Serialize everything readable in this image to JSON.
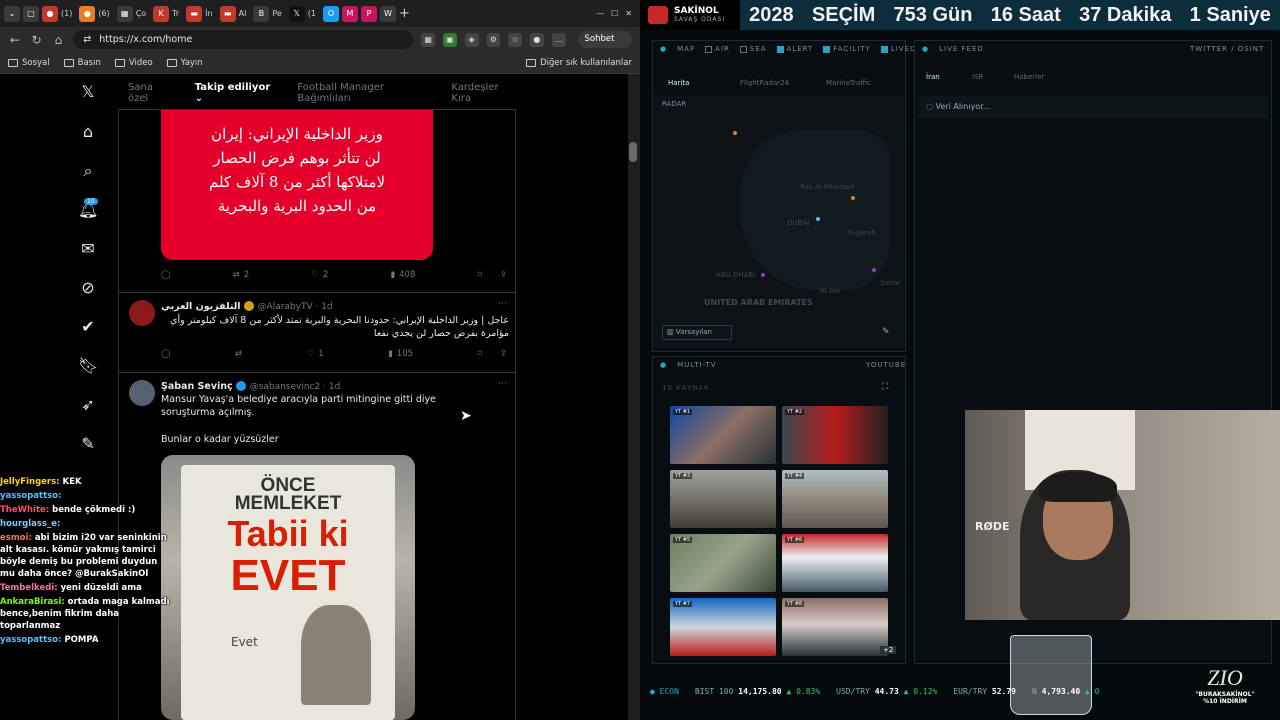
{
  "browser": {
    "tabs": [
      "(1)",
      "(6)",
      "Ço",
      "Tr",
      "İn",
      "Al",
      "Pe",
      "(1",
      "M",
      "M",
      "Ar",
      "İn",
      "W"
    ],
    "address": "https://x.com/home",
    "copilot_label": "Sohbet et",
    "bookmarks": [
      "Sosyal",
      "Basın",
      "Video",
      "Yayın"
    ],
    "bookmarks_right": "Diğer sık kullanılanlar"
  },
  "x": {
    "notification_count": "10",
    "feed_tabs": [
      "Sana özel",
      "Takip ediliyor",
      "Football Manager Bağımlıları",
      "Kardeşler Kıra"
    ],
    "tweet1": {
      "image_lines": [
        "وزير الداخلية الإيراني: إيران",
        "لن تتأثر بوهم فرض الحصار",
        "لامتلاكها أكثر من 8 آلاف كلم",
        "من الحدود البرية والبحرية"
      ],
      "retweets": "2",
      "likes": "2",
      "views": "408"
    },
    "tweet2": {
      "name": "التلفزيون العربي",
      "handle": "@AlarabyTV · 1d",
      "text_line1": "عاجل | وزير الداخلية الإيراني: حدودنا البحرية والبرية تمتد لأكثر من 8 آلاف كيلومتر وأي",
      "text_line2": "مؤامرة بفرض حصار لن يجدي نفعا",
      "likes": "1",
      "views": "105"
    },
    "tweet3": {
      "name": "Şaban Sevinç",
      "handle": "@sabansevinc2 · 1d",
      "text": "Mansur Yavaş'a belediye aracıyla parti mitingine gitti diye soruşturma açılmış.",
      "text2": "Bunlar o kadar yüzsüzler",
      "billboard_line1": "ÖNCE",
      "billboard_line2": "MEMLEKET",
      "billboard_line3": "Tabii ki",
      "billboard_line4": "EVET",
      "billboard_small": "Evet"
    }
  },
  "chat": [
    {
      "user": "JellyFingers:",
      "text": "KEK",
      "color": "#ffd700"
    },
    {
      "user": "yassopattso:",
      "text": "",
      "color": "#4fc3f7"
    },
    {
      "user": "TheWhite:",
      "text": "bende çökmedi :)",
      "color": "#ff4d6d"
    },
    {
      "user": "hourglass_e:",
      "text": "",
      "color": "#7ec8ff"
    },
    {
      "user": "esmoi:",
      "text": "abi bizim i20 var seninkinin alt kasası. kömür yakmış tamirci böyle demiş bu problemi duydun mu daha önce? @BurakSakinOl",
      "color": "#ff6b6b"
    },
    {
      "user": "Tembelkedi:",
      "text": "yeni düzeldi ama",
      "color": "#ff6b9d"
    },
    {
      "user": "AnkaraBirasi:",
      "text": "ortada maga kalmadı bence,benim fikrim daha toparlanmaz",
      "color": "#7cfc00"
    },
    {
      "user": "yassopattso:",
      "text": "POMPA",
      "color": "#4fc3f7"
    }
  ],
  "banner": {
    "logo_title": "SAKİNOL",
    "logo_sub": "SAVAŞ ODASI",
    "countdown": [
      "2028",
      "SEÇİM",
      "753 Gün",
      "16 Saat",
      "37 Dakika",
      "1 Saniye"
    ]
  },
  "dashboard": {
    "map_label": "MAP",
    "filters": [
      "AIR",
      "SEA",
      "ALERT",
      "FACILITY",
      "LIVECAM"
    ],
    "map_tabs": [
      "Harita",
      "FlightRadar24",
      "MarineTraffic"
    ],
    "radar_label": "RADAR",
    "map_places": [
      "Ras Al Khaimah",
      "DUBAI",
      "Fujairah",
      "ABU DHABI",
      "Al Ain",
      "UNITED ARAB EMIRATES",
      "Sohar"
    ],
    "map_button": "Varsayılan",
    "live_feed": "LIVE FEED",
    "live_feed_right": "TWITTER / OSINT",
    "feed_tabs": [
      "İran",
      "ISR",
      "Haberler"
    ],
    "loading": "Veri Alınıyor...",
    "multitv": "MULTI-TV",
    "multitv_right": "YOUTUBE",
    "multitv_sub": "10 KAYNAK",
    "tv_labels": [
      "YT #1",
      "YT #2",
      "YT #3",
      "YT #4",
      "YT #5",
      "YT #6",
      "YT #7",
      "YT #8"
    ],
    "more_badge": "+2",
    "econ_label": "ECON",
    "tickers": [
      {
        "name": "BIST 100",
        "value": "14,175.80",
        "chg": "▲ 0.83%"
      },
      {
        "name": "USD/TRY",
        "value": "44.73",
        "chg": "▲ 0.12%"
      },
      {
        "name": "EUR/TRY",
        "value": "52.79",
        "chg": ""
      },
      {
        "name": "N",
        "value": "4,793.40",
        "chg": "▲ 0"
      }
    ]
  },
  "webcam": {
    "mic_brand": "RØDE"
  },
  "sponsor": {
    "brand": "ZIO",
    "line1": "\"BURAKSAKİNOL\"",
    "line2": "%10 İNDİRİM"
  }
}
